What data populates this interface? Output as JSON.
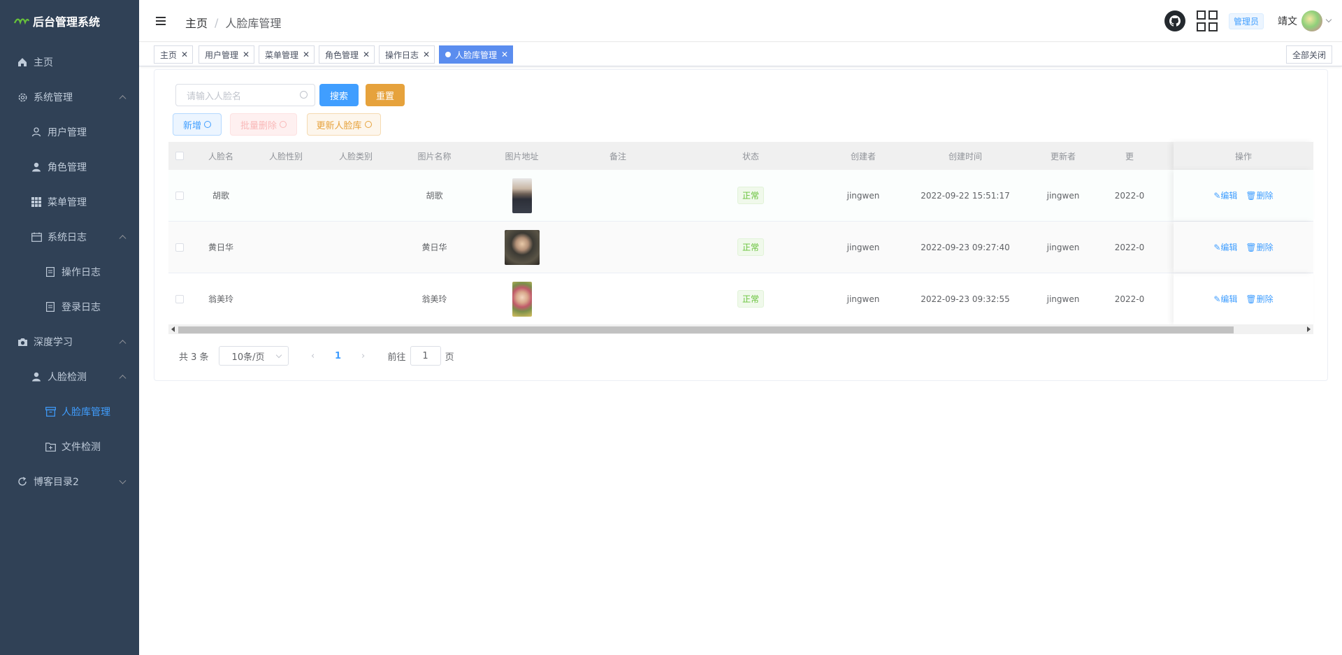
{
  "app": {
    "title": "后台管理系统"
  },
  "sidebar": {
    "items": [
      {
        "label": "主页"
      },
      {
        "label": "系统管理"
      },
      {
        "label": "用户管理"
      },
      {
        "label": "角色管理"
      },
      {
        "label": "菜单管理"
      },
      {
        "label": "系统日志"
      },
      {
        "label": "操作日志"
      },
      {
        "label": "登录日志"
      },
      {
        "label": "深度学习"
      },
      {
        "label": "人脸检测"
      },
      {
        "label": "人脸库管理"
      },
      {
        "label": "文件检测"
      },
      {
        "label": "博客目录2"
      }
    ]
  },
  "header": {
    "breadcrumb": [
      "主页",
      "人脸库管理"
    ],
    "role": "管理员",
    "username": "靖文"
  },
  "tags": {
    "items": [
      "主页",
      "用户管理",
      "菜单管理",
      "角色管理",
      "操作日志",
      "人脸库管理"
    ],
    "close_all": "全部关闭"
  },
  "toolbar": {
    "search_placeholder": "请输入人脸名",
    "search": "搜索",
    "reset": "重置",
    "add": "新增",
    "batch_delete": "批量删除",
    "update_lib": "更新人脸库"
  },
  "table": {
    "columns": [
      "人脸名",
      "人脸性别",
      "人脸类别",
      "图片名称",
      "图片地址",
      "备注",
      "状态",
      "创建者",
      "创建时间",
      "更新者",
      "更",
      "操作"
    ],
    "rows": [
      {
        "name": "胡歌",
        "img_name": "胡歌",
        "status": "正常",
        "creator": "jingwen",
        "created": "2022-09-22 15:51:17",
        "updater": "jingwen",
        "updated": "2022-0"
      },
      {
        "name": "黄日华",
        "img_name": "黄日华",
        "status": "正常",
        "creator": "jingwen",
        "created": "2022-09-23 09:27:40",
        "updater": "jingwen",
        "updated": "2022-0"
      },
      {
        "name": "翁美玲",
        "img_name": "翁美玲",
        "status": "正常",
        "creator": "jingwen",
        "created": "2022-09-23 09:32:55",
        "updater": "jingwen",
        "updated": "2022-0"
      }
    ],
    "edit": "编辑",
    "delete": "删除"
  },
  "pager": {
    "total": "共 3 条",
    "size": "10条/页",
    "current": "1",
    "prev": "‹",
    "next": "›",
    "goto_label": "前往",
    "goto_value": "1",
    "page_suffix": "页"
  }
}
